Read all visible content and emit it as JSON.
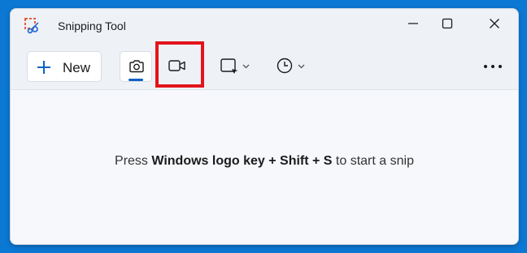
{
  "window": {
    "title": "Snipping Tool"
  },
  "toolbar": {
    "new_label": "New",
    "active_mode": "snip",
    "highlighted_button": "record-mode"
  },
  "icons": {
    "app": "snipping-tool-icon",
    "new": "plus-icon",
    "snip_mode": "camera-icon",
    "record_mode": "video-camera-icon",
    "shape": "rectangle-shape-icon",
    "delay": "clock-icon",
    "more": "more-dots-icon",
    "minimize": "minimize-icon",
    "maximize": "maximize-icon",
    "close": "close-icon"
  },
  "hint": {
    "prefix": "Press ",
    "keys": "Windows logo key + Shift + S",
    "suffix": " to start a snip"
  },
  "colors": {
    "accent": "#0b63c5",
    "highlight": "#e3141b",
    "desktop": "#0b78d4"
  }
}
